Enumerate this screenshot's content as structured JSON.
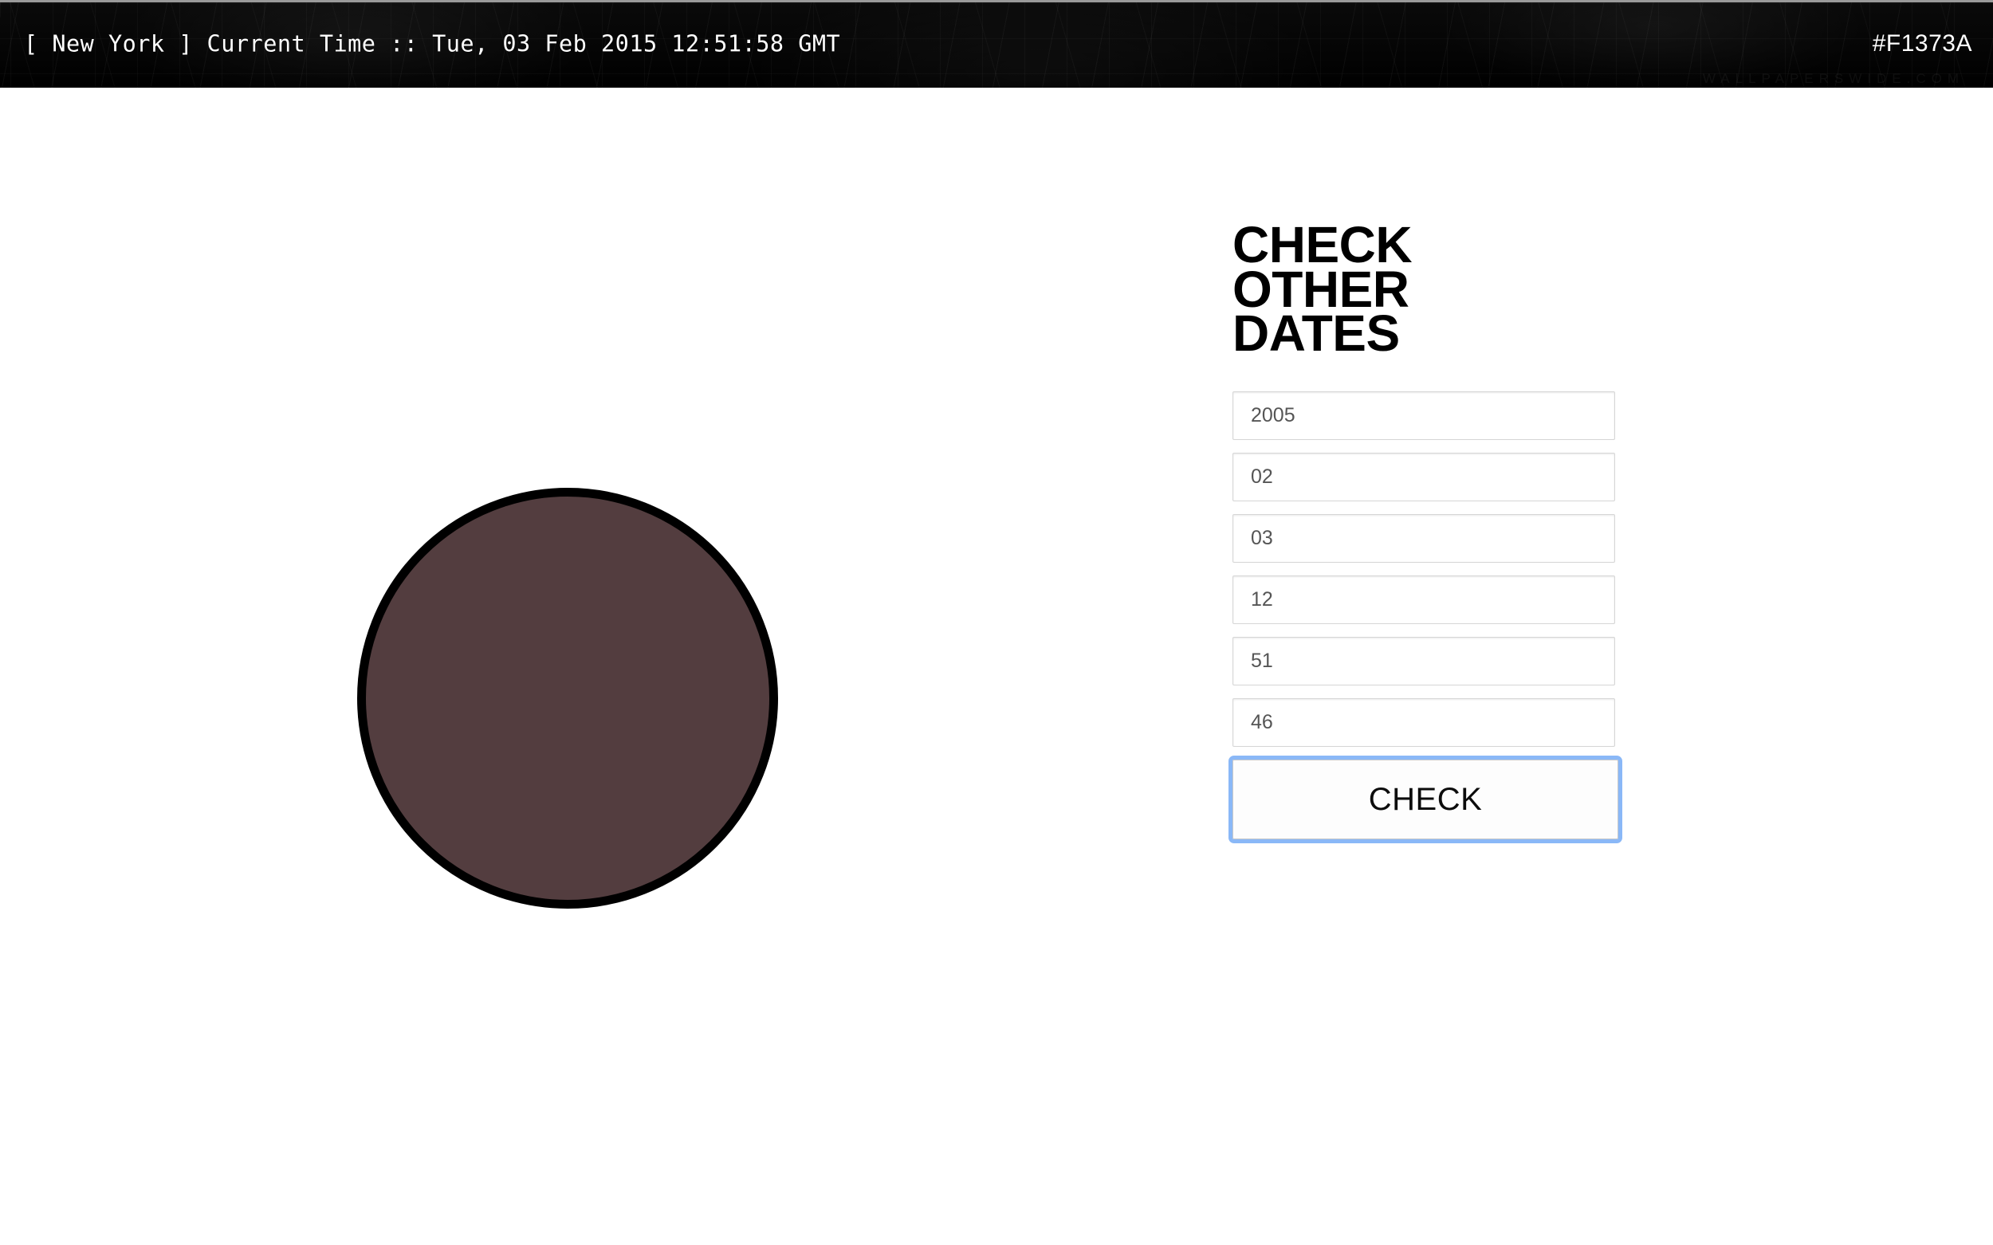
{
  "header": {
    "clock_text": "[ New York ] Current Time :: Tue, 03 Feb 2015 12:51:58 GMT",
    "city": "New York",
    "label": "Current Time",
    "timestamp": "Tue, 03 Feb 2015 12:51:58 GMT",
    "color_code": "#F1373A",
    "watermark": "WALLPAPERSWIDE.COM",
    "background_color": "#070707",
    "text_color": "#FFFFFF"
  },
  "swatch": {
    "name": "color-circle",
    "fill": "#533D3F",
    "border_color": "#000000"
  },
  "panel": {
    "title_lines": [
      "CHECK",
      "OTHER",
      "DATES"
    ],
    "title_text": "CHECK OTHER DATES",
    "fields": [
      {
        "name": "year",
        "value": "2005",
        "placeholder": "2005"
      },
      {
        "name": "month",
        "value": "02",
        "placeholder": "02"
      },
      {
        "name": "day",
        "value": "03",
        "placeholder": "03"
      },
      {
        "name": "hour",
        "value": "12",
        "placeholder": "12"
      },
      {
        "name": "minute",
        "value": "51",
        "placeholder": "51"
      },
      {
        "name": "second",
        "value": "46",
        "placeholder": "46"
      }
    ],
    "submit_label": "CHECK",
    "focus_ring_color": "#8AB8F7"
  }
}
